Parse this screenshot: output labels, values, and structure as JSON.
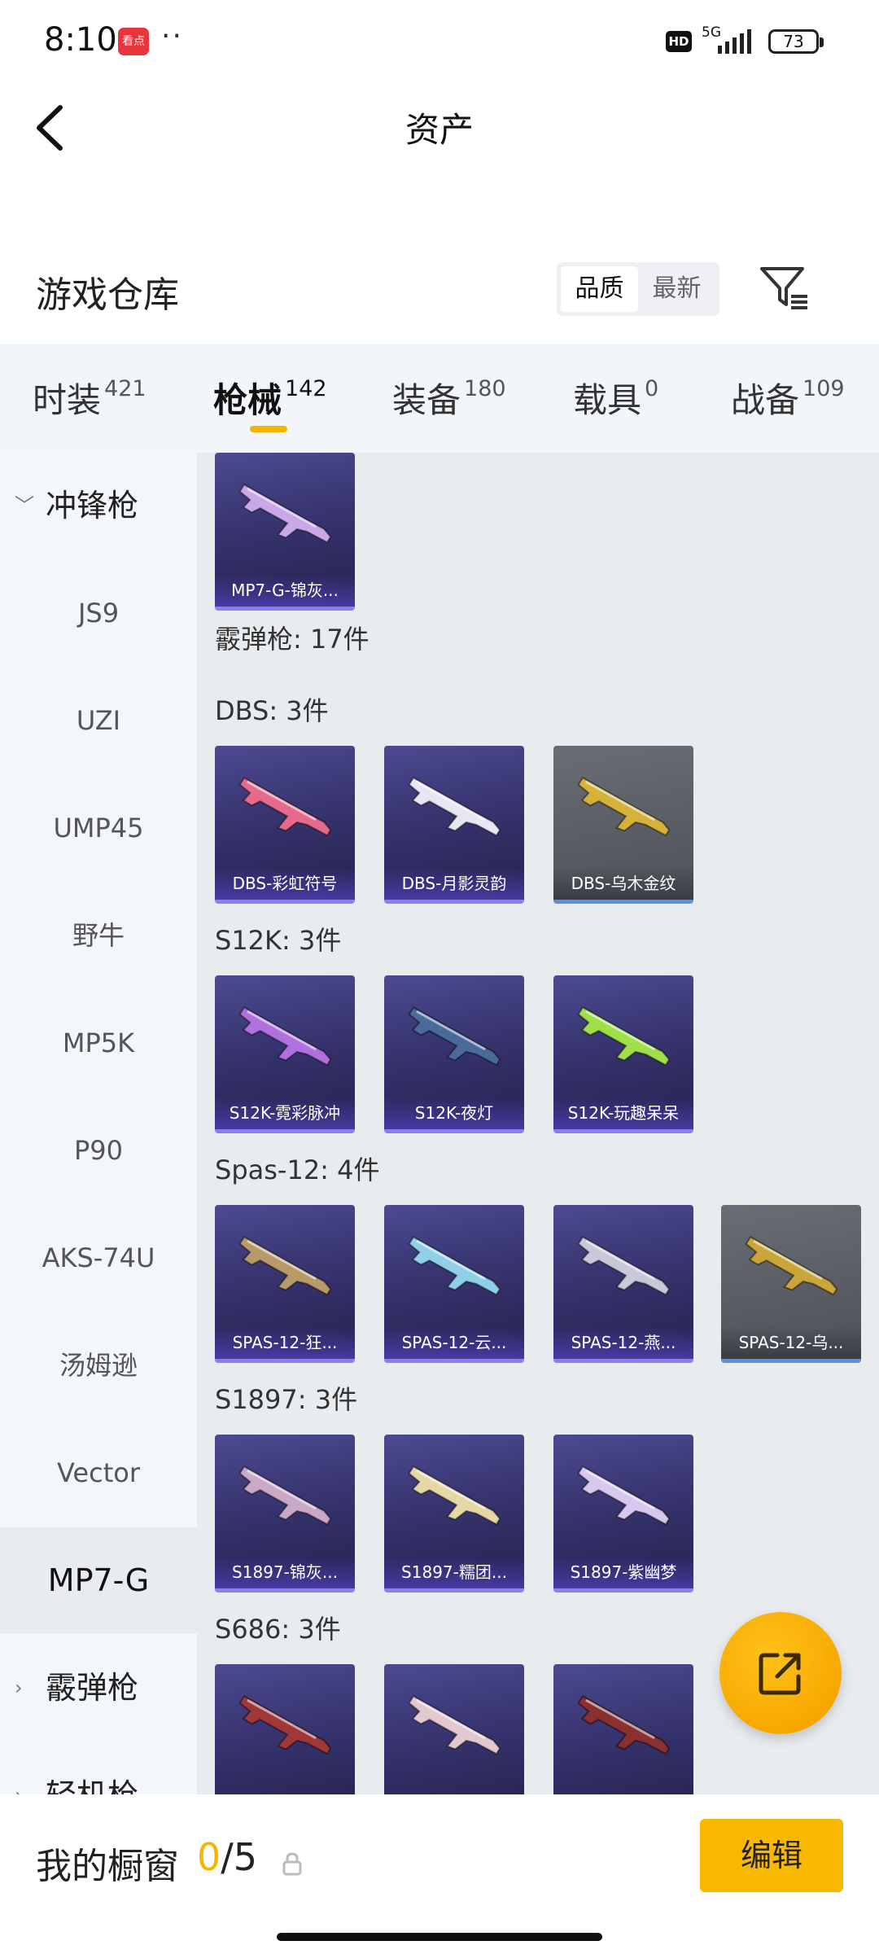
{
  "status_bar": {
    "time": "8:10",
    "app_badge": "看点",
    "more_dots": "··",
    "hd": "HD",
    "network": "5G",
    "battery": "73"
  },
  "header": {
    "title": "资产"
  },
  "section": {
    "title": "游戏仓库",
    "sort_options": [
      "品质",
      "最新"
    ],
    "sort_selected": "品质"
  },
  "tabs": [
    {
      "label": "时装",
      "count": "421"
    },
    {
      "label": "枪械",
      "count": "142",
      "active": true
    },
    {
      "label": "装备",
      "count": "180"
    },
    {
      "label": "载具",
      "count": "0"
    },
    {
      "label": "战备",
      "count": "109"
    }
  ],
  "sidebar": {
    "group_open": "冲锋枪",
    "items": [
      "JS9",
      "UZI",
      "UMP45",
      "野牛",
      "MP5K",
      "P90",
      "AKS-74U",
      "汤姆逊",
      "Vector",
      "MP7-G"
    ],
    "selected": "MP7-G",
    "group_next": "霰弹枪",
    "group_partial": "轻机枪"
  },
  "content": {
    "top_card": {
      "name": "MP7-G-锦灰...",
      "color": "#c9a8e8"
    },
    "category_summary": "霰弹枪: 17件",
    "groups": [
      {
        "label": "DBS: 3件",
        "items": [
          {
            "name": "DBS-彩虹符号",
            "color": "#e56a8c",
            "grey": false
          },
          {
            "name": "DBS-月影灵韵",
            "color": "#e8e6f2",
            "grey": false
          },
          {
            "name": "DBS-乌木金纹",
            "color": "#d6b23a",
            "grey": true
          }
        ]
      },
      {
        "label": "S12K: 3件",
        "items": [
          {
            "name": "S12K-霓彩脉冲",
            "color": "#b070e0",
            "grey": false
          },
          {
            "name": "S12K-夜灯",
            "color": "#4a6a9a",
            "grey": false
          },
          {
            "name": "S12K-玩趣呆呆",
            "color": "#9fe04a",
            "grey": false
          }
        ]
      },
      {
        "label": "Spas-12: 4件",
        "items": [
          {
            "name": "SPAS-12-狂...",
            "color": "#b89a6a",
            "grey": false
          },
          {
            "name": "SPAS-12-云...",
            "color": "#8fd0e8",
            "grey": false
          },
          {
            "name": "SPAS-12-燕...",
            "color": "#c8c8d8",
            "grey": false
          },
          {
            "name": "SPAS-12-乌...",
            "color": "#c9a53a",
            "grey": true
          }
        ]
      },
      {
        "label": "S1897: 3件",
        "items": [
          {
            "name": "S1897-锦灰...",
            "color": "#c9a8c8",
            "grey": false
          },
          {
            "name": "S1897-糯团...",
            "color": "#e6d7a6",
            "grey": false
          },
          {
            "name": "S1897-紫幽梦",
            "color": "#d8c8f0",
            "grey": false
          }
        ]
      },
      {
        "label": "S686: 3件",
        "items": [
          {
            "name": "",
            "color": "#a0383a",
            "grey": false
          },
          {
            "name": "",
            "color": "#e2c8d0",
            "grey": false
          },
          {
            "name": "",
            "color": "#8a3030",
            "grey": false
          }
        ]
      }
    ]
  },
  "bottom_bar": {
    "showcase_label": "我的橱窗",
    "showcase_current": "0",
    "showcase_total": "/5",
    "edit_label": "编辑"
  },
  "colors": {
    "accent": "#f8b800",
    "card_bg": "#37346f",
    "card_rare_border": "#8c7df0",
    "card_grey_bg": "#595c63",
    "card_grey_border": "#5b8fe6"
  }
}
